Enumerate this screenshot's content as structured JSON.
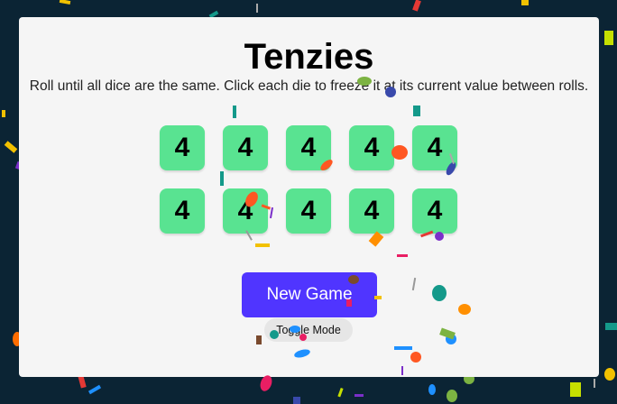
{
  "game": {
    "title": "Tenzies",
    "instructions": "Roll until all dice are the same. Click each die to freeze it at its current value between rolls.",
    "dice": [
      "4",
      "4",
      "4",
      "4",
      "4",
      "4",
      "4",
      "4",
      "4",
      "4"
    ],
    "new_game_label": "New Game",
    "toggle_mode_label": "Toggle Mode"
  },
  "colors": {
    "page_background": "#0b2434",
    "card_background": "#f5f5f5",
    "die_held": "#59e391",
    "button_primary": "#5035ff",
    "button_secondary": "#e6e6e6"
  }
}
